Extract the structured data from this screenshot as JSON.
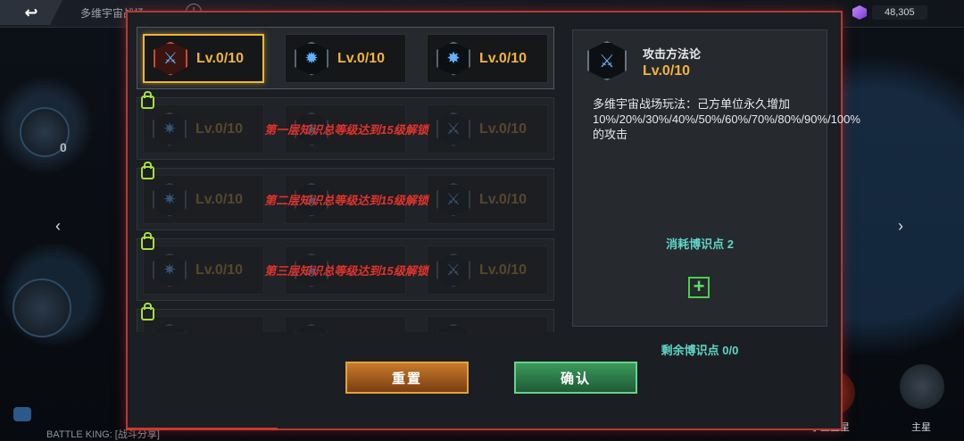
{
  "top": {
    "title": "多维宇宙战场",
    "back_glyph": "↩",
    "info_glyph": "!",
    "currency": "48,305"
  },
  "background": {
    "orb_count": "0",
    "battle_text": "BATTLE KING: [战斗分享]",
    "nav_satellite": "小型卫星",
    "nav_main_star": "主星"
  },
  "rows": [
    {
      "locked": false,
      "lock_text": "",
      "cells": [
        {
          "icon": "sword-icon",
          "glyph": "⚔",
          "level": "Lv.0/10",
          "selected": true
        },
        {
          "icon": "star-burst-icon",
          "glyph": "✹",
          "level": "Lv.0/10",
          "selected": false
        },
        {
          "icon": "sparkle-icon",
          "glyph": "✸",
          "level": "Lv.0/10",
          "selected": false
        }
      ]
    },
    {
      "locked": true,
      "lock_text": "第一层知识总等级达到15级解锁",
      "cells": [
        {
          "icon": "gear-star-icon",
          "glyph": "✷",
          "level": "Lv.0/10"
        },
        {
          "icon": "shield-icon",
          "glyph": "◈",
          "level": ""
        },
        {
          "icon": "sword-icon",
          "glyph": "⚔",
          "level": "Lv.0/10"
        }
      ]
    },
    {
      "locked": true,
      "lock_text": "第二层知识总等级达到15级解锁",
      "cells": [
        {
          "icon": "gear-star-icon",
          "glyph": "✷",
          "level": "Lv.0/10"
        },
        {
          "icon": "shield-icon",
          "glyph": "◈",
          "level": ""
        },
        {
          "icon": "sword-icon",
          "glyph": "⚔",
          "level": "Lv.0/10"
        }
      ]
    },
    {
      "locked": true,
      "lock_text": "第三层知识总等级达到15级解锁",
      "cells": [
        {
          "icon": "gear-star-icon",
          "glyph": "✷",
          "level": "Lv.0/10"
        },
        {
          "icon": "shield-icon",
          "glyph": "◈",
          "level": ""
        },
        {
          "icon": "sword-icon",
          "glyph": "⚔",
          "level": "Lv.0/10"
        }
      ]
    },
    {
      "locked": true,
      "lock_text": "",
      "cells": [
        {
          "icon": "gear-star-icon",
          "glyph": "✷",
          "level": ""
        },
        {
          "icon": "shield-icon",
          "glyph": "◈",
          "level": ""
        },
        {
          "icon": "sword-icon",
          "glyph": "⚔",
          "level": ""
        }
      ]
    }
  ],
  "detail": {
    "icon": "sword-icon",
    "glyph": "⚔",
    "name": "攻击方法论",
    "level": "Lv.0/10",
    "description": "多维宇宙战场玩法：己方单位永久增加10%/20%/30%/40%/50%/60%/70%/80%/90%/100%的攻击",
    "cost": "消耗博识点 2",
    "plus": "+"
  },
  "remaining": "剩余博识点 0/0",
  "buttons": {
    "reset": "重置",
    "confirm": "确认"
  },
  "colors": {
    "frame": "#b43a33",
    "level_gold": "#f2b33a",
    "lock_red": "#e0332b",
    "teal": "#5fd6c7",
    "selection": "#f0b733"
  }
}
